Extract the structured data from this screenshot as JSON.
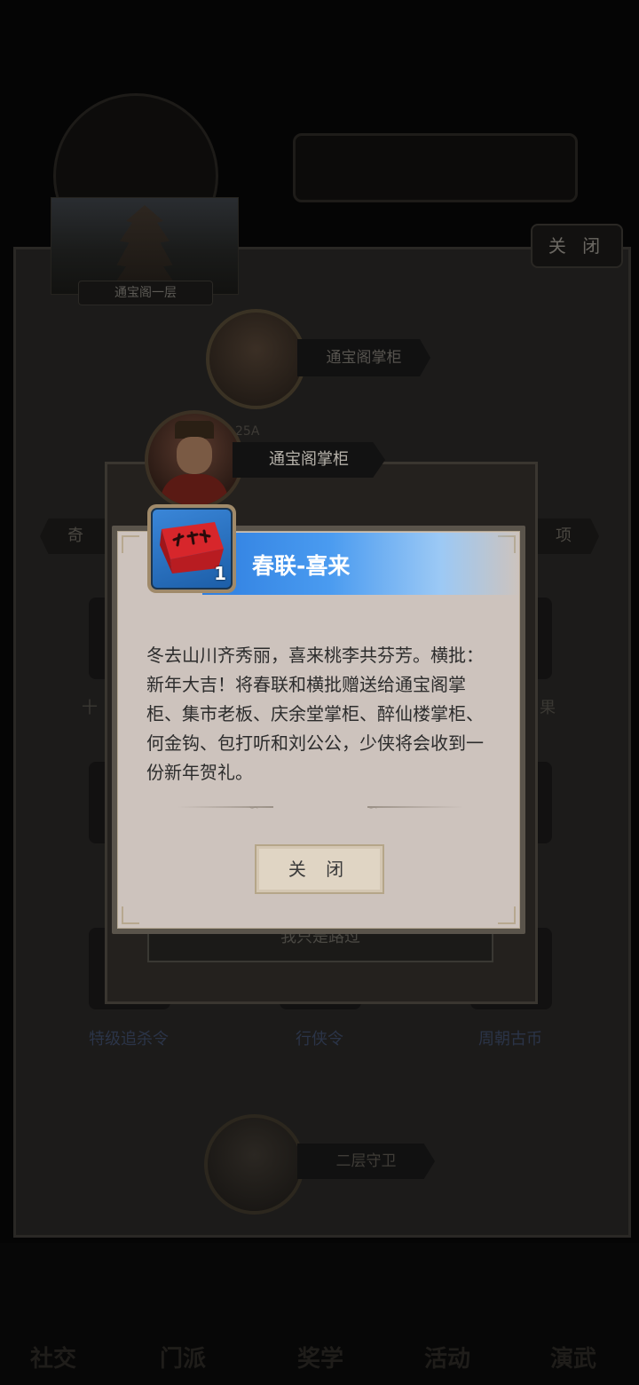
{
  "background": {
    "floor_label": "通宝阁一层",
    "close_label": "关 闭",
    "npc1_name": "通宝阁掌柜",
    "stats_text": "25A",
    "tab_left": "奇",
    "tab_right": "项",
    "grid_labels": [
      "特级追杀令",
      "行侠令",
      "周朝古币"
    ],
    "behind_button": "我只是路过",
    "npc2_name": "二层守卫",
    "side_partial_left": "十",
    "side_partial_right": "果",
    "nav": [
      "社交",
      "门派",
      "奖学",
      "活动",
      "演武"
    ]
  },
  "dialog": {
    "npc_name": "通宝阁掌柜"
  },
  "item_popup": {
    "icon": "red-couplet-icon",
    "quantity": "1",
    "title": "春联-喜来",
    "description": "冬去山川齐秀丽，喜来桃李共芬芳。横批：新年大吉！将春联和横批赠送给通宝阁掌柜、集市老板、庆余堂掌柜、醉仙楼掌柜、何金钩、包打听和刘公公，少侠将会收到一份新年贺礼。",
    "close_label": "关 闭"
  },
  "colors": {
    "title_bar_blue": "#2f7fe0",
    "popup_parchment": "#cdc3bd",
    "overlay": "#050505"
  }
}
